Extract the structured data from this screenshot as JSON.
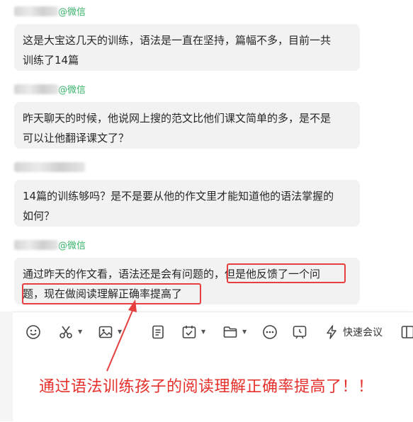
{
  "messages": [
    {
      "sender_suffix": "@微信",
      "text_lines": [
        "这是大宝这几天的训练，语法是一直在坚持，篇幅不多，目前一共",
        "训练了14篇"
      ]
    },
    {
      "sender_suffix": "@微信",
      "text_lines": [
        "昨天聊天的时候，他说网上搜的范文比他们课文简单的多，是不是",
        "可以让他翻译课文了？"
      ]
    },
    {
      "sender_suffix": "",
      "text_lines": [
        "14篇的训练够吗？是不是要从他的作文里才能知道他的语法掌握的",
        "如何？"
      ]
    },
    {
      "sender_suffix": "@微信",
      "text_lines": [
        "通过昨天的作文看，语法还是会有问题的，但是他反馈了一个问",
        "题，现在做阅读理解正确率提高了"
      ]
    }
  ],
  "toolbar": {
    "icons": [
      "emoji-icon",
      "scissors-icon",
      "image-icon",
      "document-icon",
      "task-icon",
      "folder-icon",
      "more-icon",
      "schedule-icon",
      "lightning-icon",
      "sidebar-icon"
    ],
    "quick_meeting_label": "快速会议"
  },
  "annotation": {
    "text": "通过语法训练孩子的阅读理解正确率提高了！！",
    "color": "#e5302b"
  },
  "colors": {
    "sender_green": "#39b36a",
    "bubble_bg": "#f2f2f2",
    "highlight_red": "#e53f3f"
  }
}
